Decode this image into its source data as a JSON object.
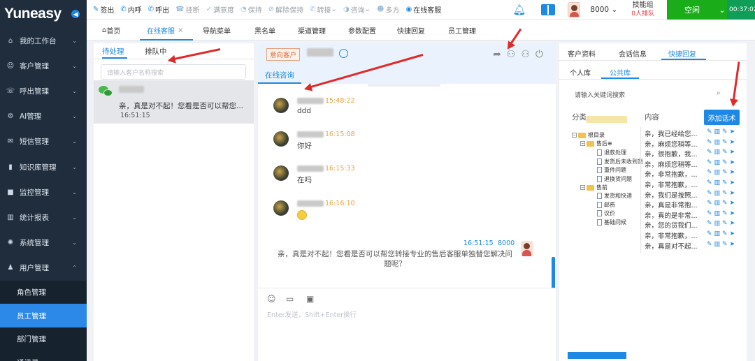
{
  "app": {
    "logo": "Yuneasy",
    "collapse_icon": "circle-arrow-icon"
  },
  "sidebar": {
    "items": [
      {
        "label": "我的工作台",
        "icon": "home-icon",
        "glyph": "⌂"
      },
      {
        "label": "客户管理",
        "icon": "users-icon",
        "glyph": "☺"
      },
      {
        "label": "呼出管理",
        "icon": "headset-icon",
        "glyph": "☏"
      },
      {
        "label": "AI管理",
        "icon": "robot-icon",
        "glyph": "⚙"
      },
      {
        "label": "短信管理",
        "icon": "mail-icon",
        "glyph": "✉"
      },
      {
        "label": "知识库管理",
        "icon": "library-icon",
        "glyph": "▮"
      },
      {
        "label": "监控管理",
        "icon": "camera-icon",
        "glyph": "■"
      },
      {
        "label": "统计报表",
        "icon": "bar-chart-icon",
        "glyph": "▥"
      },
      {
        "label": "系统管理",
        "icon": "gear-icon",
        "glyph": "✺"
      },
      {
        "label": "用户管理",
        "icon": "person-icon",
        "glyph": "♟"
      }
    ],
    "sub_items": [
      {
        "label": "角色管理",
        "active": false
      },
      {
        "label": "员工管理",
        "active": true
      },
      {
        "label": "部门管理",
        "active": false
      },
      {
        "label": "通讯录",
        "active": false
      }
    ]
  },
  "toolbar": {
    "buttons": [
      {
        "label": "签出",
        "icon": "edit-icon",
        "glyph": "✎",
        "dim": false
      },
      {
        "label": "内呼",
        "icon": "phone-icon",
        "glyph": "✆",
        "dim": false
      },
      {
        "label": "呼出",
        "icon": "phone-out-icon",
        "glyph": "✆",
        "dim": false
      },
      {
        "label": "挂断",
        "icon": "hangup-icon",
        "glyph": "☎",
        "dim": true
      },
      {
        "label": "满意度",
        "icon": "thumb-icon",
        "glyph": "✓",
        "dim": true
      },
      {
        "label": "保持",
        "icon": "hold-icon",
        "glyph": "◔",
        "dim": true
      },
      {
        "label": "解除保持",
        "icon": "unhold-icon",
        "glyph": "⊘",
        "dim": true
      },
      {
        "label": "转接",
        "icon": "transfer-icon",
        "glyph": "✆",
        "dim": true,
        "dropdown": "⌄"
      },
      {
        "label": "咨询",
        "icon": "consult-icon",
        "glyph": "◑",
        "dim": true,
        "dropdown": "⌄"
      },
      {
        "label": "多方",
        "icon": "conference-icon",
        "glyph": "☻",
        "dim": true
      },
      {
        "label": "在线客服",
        "icon": "online-service-icon",
        "glyph": "◉",
        "dim": false
      }
    ],
    "extension": "8000",
    "skill_group": "技能组",
    "queue_count": "0人排队",
    "status": "空闲",
    "timer": "00:37:02"
  },
  "tabs": [
    {
      "label": "首页",
      "icon": "home-icon",
      "active": false
    },
    {
      "label": "在线客服",
      "active": true,
      "closable": true
    },
    {
      "label": "导航菜单",
      "active": false
    },
    {
      "label": "黑名单",
      "active": false
    },
    {
      "label": "渠道管理",
      "active": false
    },
    {
      "label": "参数配置",
      "active": false
    },
    {
      "label": "快捷回复",
      "active": false
    },
    {
      "label": "员工管理",
      "active": false
    }
  ],
  "left_panel": {
    "tabs": [
      {
        "label": "待处理",
        "active": true
      },
      {
        "label": "排队中",
        "active": false
      }
    ],
    "search_placeholder": "请输入客户名称搜索",
    "conversation": {
      "preview": "亲，真是对不起！您看是否可以帮您...",
      "time": "16:51:15"
    }
  },
  "chat": {
    "tag": "意向客户",
    "subtab": "在线咨询",
    "messages": [
      {
        "time": "15:48:22",
        "text": "ddd"
      },
      {
        "time": "16:15:08",
        "text": "你好"
      },
      {
        "time": "16:15:33",
        "text": "在吗"
      },
      {
        "time": "16:16:10",
        "text": "🙂"
      }
    ],
    "outgoing": {
      "time": "16:51:15",
      "agent": "8000",
      "text": "亲，真是对不起！您看是否可以帮您转接专业的售后客服单独替您解决问题呢？"
    },
    "input_placeholder": "Enter发送，Shift+Enter换行"
  },
  "right_panel": {
    "tabs": [
      {
        "label": "客户资料",
        "active": false
      },
      {
        "label": "会话信息",
        "active": false
      },
      {
        "label": "快捷回复",
        "active": true
      }
    ],
    "subtabs": [
      {
        "label": "个人库",
        "active": false
      },
      {
        "label": "公共库",
        "active": true
      }
    ],
    "search_placeholder": "请输入关键词搜索",
    "col_category": "分类",
    "col_content": "内容",
    "add_button": "添加话术",
    "tree": {
      "root": "根目录",
      "g1": "售后",
      "g1_items": [
        "退款处理",
        "发货后未收到货",
        "重件问题",
        "退换货问题"
      ],
      "g2": "售前",
      "g2_items": [
        "发货和快递",
        "邮费",
        "议价",
        "基础问候"
      ]
    },
    "replies": [
      "亲，我已经给您...",
      "亲，麻烦您稍等...",
      "亲，很抱歉，我...",
      "亲，麻烦您稍等...",
      "亲，非常抱歉，...",
      "亲，非常抱歉，...",
      "亲，我们是按照...",
      "亲，真是非常抱...",
      "亲，真的是非常...",
      "亲，您的货我们...",
      "亲，非常抱歉，...",
      "亲，真是对不起..."
    ]
  }
}
